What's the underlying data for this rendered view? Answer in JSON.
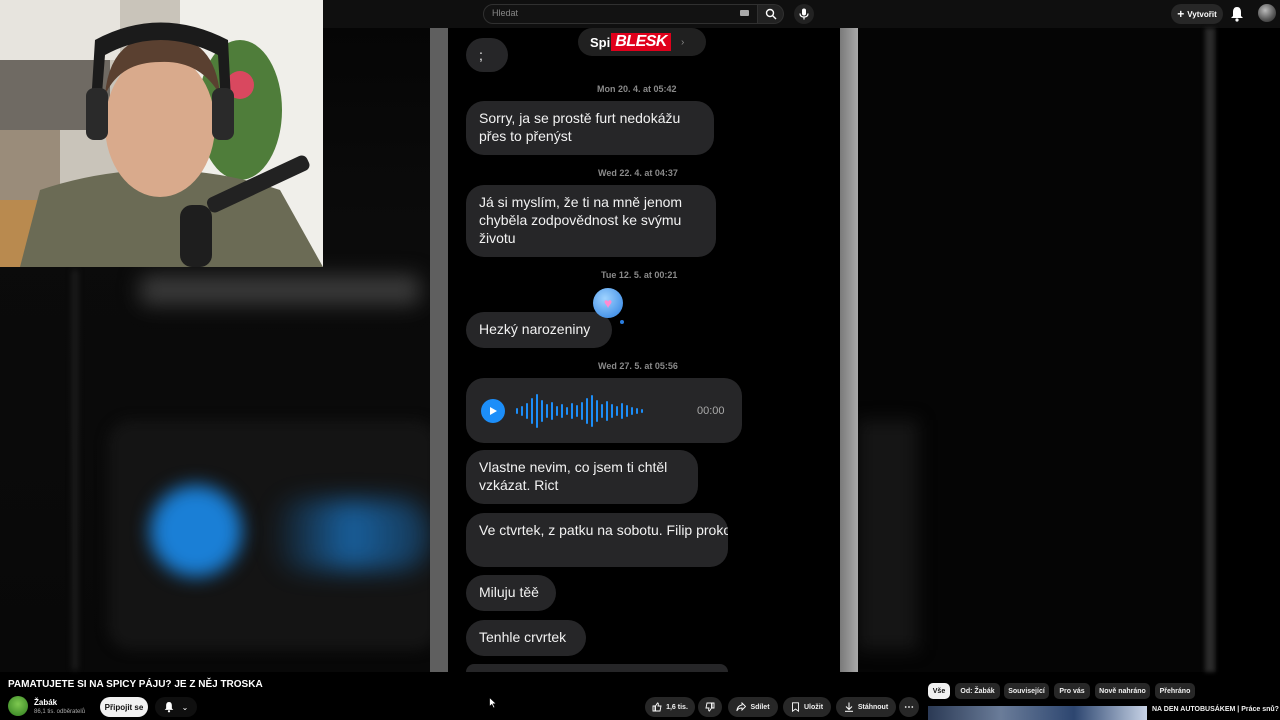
{
  "topbar": {
    "search_placeholder": "Hledat",
    "create_label": "Vytvořit"
  },
  "video": {
    "brand_spi": "Spi",
    "brand_blesk": "BLESK",
    "chat": [
      {
        "type": "bubble",
        "text": ";"
      },
      {
        "type": "timestamp",
        "text": "Mon 20. 4. at 05:42"
      },
      {
        "type": "bubble",
        "text": "Sorry, ja se prostě furt nedokážu přes to přenýst"
      },
      {
        "type": "timestamp",
        "text": "Wed 22. 4. at 04:37"
      },
      {
        "type": "bubble",
        "text": "Já si myslím, že ti na mně jenom chyběla zodpovědnost ke svýmu životu"
      },
      {
        "type": "timestamp",
        "text": "Tue 12. 5. at 00:21"
      },
      {
        "type": "bubble",
        "text": "Hezký narozeniny"
      },
      {
        "type": "timestamp",
        "text": "Wed 27. 5. at 05:56"
      },
      {
        "type": "audio",
        "text": "00:00"
      },
      {
        "type": "bubble",
        "text": "Vlastne nevim, co jsem ti chtěl vzkázat. Rict"
      },
      {
        "type": "bubble",
        "text": "Ve ctvrtek, z patku na sobotu. Filip prokop ma svatbuu. Moc rad bych t"
      },
      {
        "type": "bubble",
        "text": "Miluju těě"
      },
      {
        "type": "bubble",
        "text": "Tenhle crvrtek"
      }
    ]
  },
  "below": {
    "title": "PAMATUJETE SI NA SPICY PÁJU? JE Z NĚJ TROSKA",
    "channel_name": "Žabák",
    "channel_subs": "86,1 tis. odběratelů",
    "subscribe_label": "Připojit se",
    "like_count": "1,6 tis.",
    "share_label": "Sdílet",
    "save_label": "Uložit",
    "download_label": "Stáhnout"
  },
  "chips": [
    "Vše",
    "Od: Žabák",
    "Související",
    "Pro vás",
    "Nově nahráno",
    "Přehráno"
  ],
  "recommendation": {
    "title": "NA DEN AUTOBUSÁKEM | Práce snů?"
  },
  "colors": {
    "accent": "#1c8ef9",
    "bubble": "#262628",
    "blesk": "#e0001b"
  }
}
